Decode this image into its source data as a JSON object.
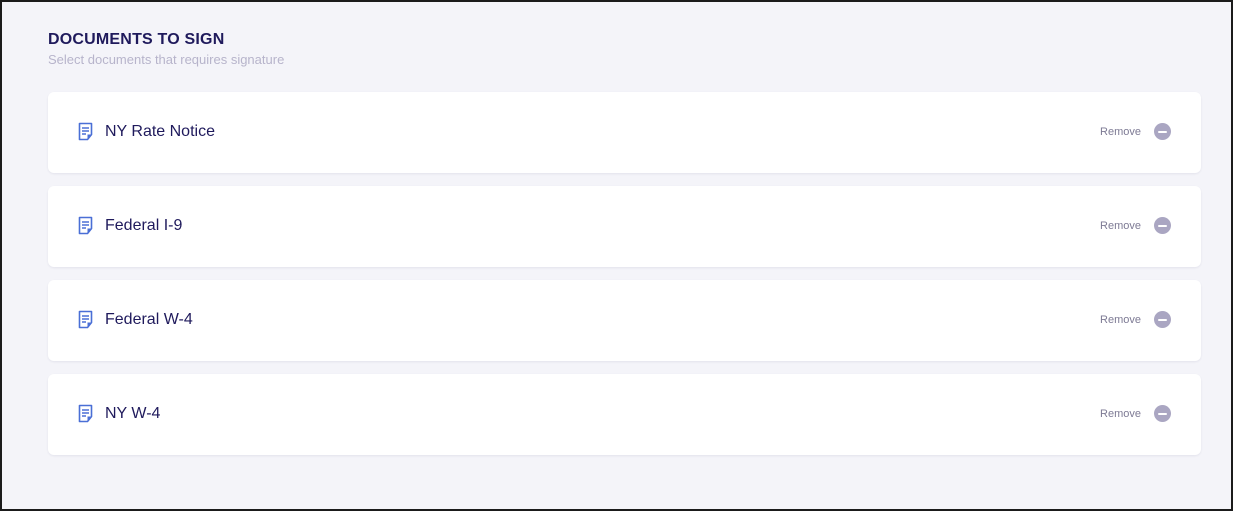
{
  "section": {
    "title": "DOCUMENTS TO SIGN",
    "subtitle": "Select documents that requires signature"
  },
  "documents": [
    {
      "name": "NY Rate Notice",
      "remove_label": "Remove",
      "icon": "document-icon"
    },
    {
      "name": "Federal I-9",
      "remove_label": "Remove",
      "icon": "document-icon"
    },
    {
      "name": "Federal W-4",
      "remove_label": "Remove",
      "icon": "document-icon"
    },
    {
      "name": "NY W-4",
      "remove_label": "Remove",
      "icon": "document-icon"
    }
  ],
  "colors": {
    "accent": "#4a6fd6",
    "title": "#1f1a5c",
    "remove_icon": "#aaa6c2",
    "background": "#f4f4f9"
  }
}
